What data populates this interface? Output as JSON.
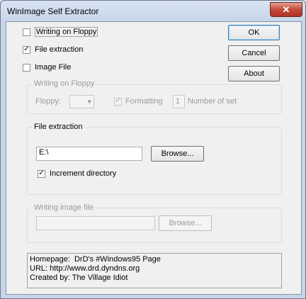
{
  "window": {
    "title": "WinImage Self Extractor",
    "close_glyph": "✕"
  },
  "options": {
    "writing_on_floppy": {
      "label": "Writing on Floppy",
      "checked": false
    },
    "file_extraction": {
      "label": "File extraction",
      "checked": true
    },
    "image_file": {
      "label": "Image File",
      "checked": false
    }
  },
  "buttons": {
    "ok": "OK",
    "cancel": "Cancel",
    "about": "About"
  },
  "floppy_group": {
    "legend": "Writing on Floppy",
    "floppy_label": "Floppy:",
    "floppy_value": "",
    "formatting_label": "Formatting",
    "formatting_checked": true,
    "number_value": "1",
    "number_label": "Number of set"
  },
  "extraction_group": {
    "legend": "File extraction",
    "path_value": "E:\\",
    "browse_label": "Browse...",
    "increment_label": "Increment directory",
    "increment_checked": true
  },
  "image_group": {
    "legend": "Writing image file",
    "path_value": "",
    "browse_label": "Browse..."
  },
  "info_text": "Homepage:  DrD's #Windows95 Page\nURL: http://www.drd.dyndns.org\nCreated by: The Village Idiot",
  "icons": {
    "check": "✓",
    "dropdown_arrow": "▾"
  }
}
